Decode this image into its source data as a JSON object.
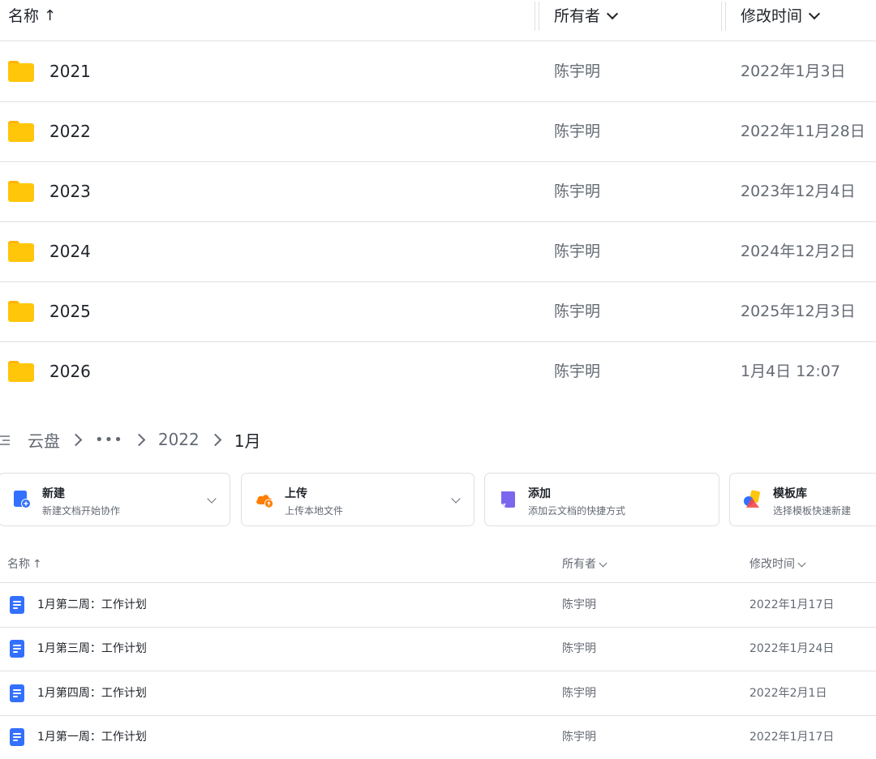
{
  "top_table": {
    "headers": {
      "name": "名称",
      "owner": "所有者",
      "modified": "修改时间"
    },
    "rows": [
      {
        "name": "2021",
        "owner": "陈宇明",
        "modified": "2022年1月3日"
      },
      {
        "name": "2022",
        "owner": "陈宇明",
        "modified": "2022年11月28日"
      },
      {
        "name": "2023",
        "owner": "陈宇明",
        "modified": "2023年12月4日"
      },
      {
        "name": "2024",
        "owner": "陈宇明",
        "modified": "2024年12月2日"
      },
      {
        "name": "2025",
        "owner": "陈宇明",
        "modified": "2025年12月3日"
      },
      {
        "name": "2026",
        "owner": "陈宇明",
        "modified": "1月4日 12:07"
      }
    ]
  },
  "breadcrumb": {
    "root": "云盘",
    "ellipsis": "•••",
    "parent": "2022",
    "current": "1月"
  },
  "actions": [
    {
      "title": "新建",
      "subtitle": "新建文档开始协作",
      "color": "#3370ff"
    },
    {
      "title": "上传",
      "subtitle": "上传本地文件",
      "color": "#ff7d00"
    },
    {
      "title": "添加",
      "subtitle": "添加云文档的快捷方式",
      "color": "#7b67ee"
    },
    {
      "title": "模板库",
      "subtitle": "选择模板快速新建",
      "color": "#f54a45"
    }
  ],
  "bottom_table": {
    "headers": {
      "name": "名称",
      "owner": "所有者",
      "modified": "修改时间"
    },
    "rows": [
      {
        "name": "1月第二周：工作计划",
        "owner": "陈宇明",
        "modified": "2022年1月17日"
      },
      {
        "name": "1月第三周：工作计划",
        "owner": "陈宇明",
        "modified": "2022年1月24日"
      },
      {
        "name": "1月第四周：工作计划",
        "owner": "陈宇明",
        "modified": "2022年2月1日"
      },
      {
        "name": "1月第一周：工作计划",
        "owner": "陈宇明",
        "modified": "2022年1月17日"
      }
    ]
  }
}
